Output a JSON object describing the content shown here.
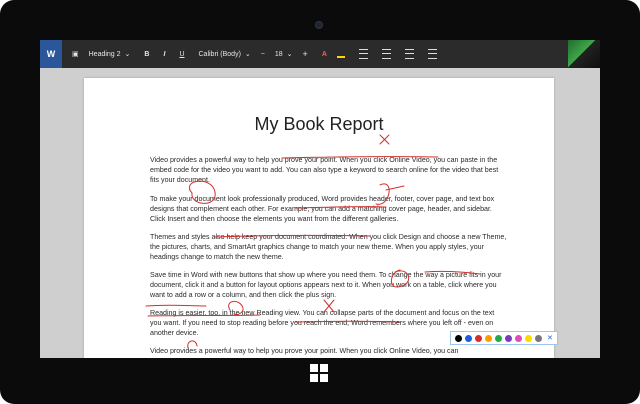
{
  "toolbar": {
    "app_logo": "W",
    "style": "Heading 2",
    "font": "Calibri (Body)",
    "size": "18",
    "bold": "B",
    "italic": "I",
    "underline": "U",
    "minus": "−",
    "plus": "+",
    "font_color_label": "A",
    "icons": [
      "file-icon",
      "plus-icon",
      "font-color-icon",
      "highlighter-icon",
      "align-left-icon",
      "align-center-icon",
      "align-right-icon",
      "align-justify-icon"
    ]
  },
  "document": {
    "title": "My Book Report",
    "paragraphs": [
      "Video provides a powerful way to help you prove your point. When you click Online Video, you can paste in the embed code for the video you want to add. You can also type a keyword to search online for the video that best fits your document.",
      "To make your document look professionally produced, Word provides header, footer, cover page, and text box designs that complement each other. For example, you can add a matching cover page, header, and sidebar. Click Insert and then choose the elements you want from the different galleries.",
      "Themes and styles also help keep your document coordinated. When you click Design and choose a new Theme, the pictures, charts, and SmartArt graphics change to match your new theme. When you apply styles, your headings change to match the new theme.",
      "Save time in Word with new buttons that show up where you need them. To change the way a picture fits in your document, click it and a button for layout options appears next to it. When you work on a table, click where you want to add a row or a column, and then click the plus sign.",
      "Reading is easier, too, in the new Reading view. You can collapse parts of the document and focus on the text you want. If you need to stop reading before you reach the end, Word remembers where you left off - even on another device.",
      "Video provides a powerful way to help you prove your point. When you click Online Video, you can"
    ]
  },
  "ink_palette": {
    "colors": [
      "#000000",
      "#1f5fd6",
      "#d0312d",
      "#ff9d00",
      "#27a844",
      "#7a3db8",
      "#e04bb5",
      "#ffd800",
      "#777777"
    ],
    "icons": [
      "pen-icon",
      "highlighter-icon",
      "eraser-icon",
      "undo-icon",
      "selection-icon",
      "close-icon"
    ]
  },
  "colors": {
    "accent": "#2b579a",
    "ink": "#d0312d"
  }
}
